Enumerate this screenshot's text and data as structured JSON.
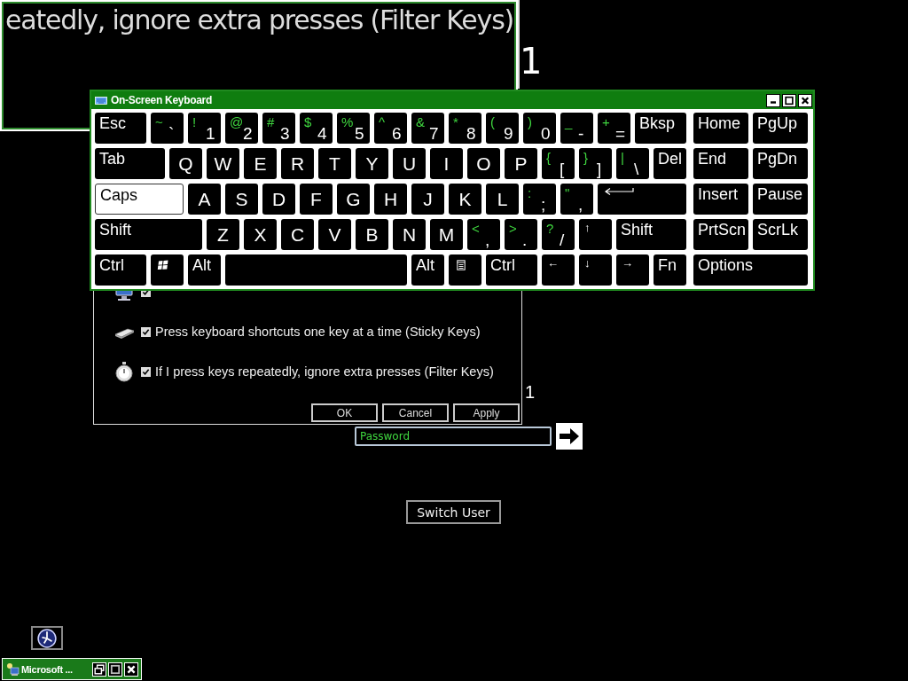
{
  "magnifier": {
    "text": "eatedly, ignore extra presses (Filter Keys)",
    "side_text": "1"
  },
  "accessibility_dialog": {
    "options": [
      {
        "checked": true
      },
      {
        "label": "Press keyboard shortcuts one key at a time (Sticky Keys)",
        "checked": true
      },
      {
        "label": "If I press keys repeatedly, ignore extra presses (Filter Keys)",
        "checked": true
      }
    ],
    "buttons": [
      "OK",
      "Cancel",
      "Apply"
    ],
    "side_text": "1"
  },
  "on_screen_keyboard": {
    "title": "On-Screen Keyboard",
    "rows": [
      {
        "keys": [
          {
            "kind": "text",
            "label": "Esc",
            "pressed": false
          },
          {
            "kind": "dual",
            "shift": "~",
            "label": "`",
            "pressed": false
          },
          {
            "kind": "dual",
            "shift": "!",
            "label": "1",
            "pressed": false
          },
          {
            "kind": "dual",
            "shift": "@",
            "label": "2",
            "pressed": false
          },
          {
            "kind": "dual",
            "shift": "#",
            "label": "3",
            "pressed": false
          },
          {
            "kind": "dual",
            "shift": "$",
            "label": "4",
            "pressed": false
          },
          {
            "kind": "dual",
            "shift": "%",
            "label": "5",
            "pressed": false
          },
          {
            "kind": "dual",
            "shift": "^",
            "label": "6",
            "pressed": false
          },
          {
            "kind": "dual",
            "shift": "&",
            "label": "7",
            "pressed": false
          },
          {
            "kind": "dual",
            "shift": "*",
            "label": "8",
            "pressed": false
          },
          {
            "kind": "dual",
            "shift": "(",
            "label": "9",
            "pressed": false
          },
          {
            "kind": "dual",
            "shift": ")",
            "label": "0",
            "pressed": false
          },
          {
            "kind": "dual",
            "shift": "_",
            "label": "-",
            "pressed": false
          },
          {
            "kind": "dual",
            "shift": "+",
            "label": "=",
            "pressed": false
          },
          {
            "kind": "text",
            "label": "Bksp",
            "pressed": false
          }
        ]
      },
      {
        "keys": [
          {
            "kind": "text",
            "label": "Tab",
            "pressed": false
          },
          {
            "kind": "letter",
            "label": "Q",
            "pressed": false
          },
          {
            "kind": "letter",
            "label": "W",
            "pressed": false
          },
          {
            "kind": "letter",
            "label": "E",
            "pressed": false
          },
          {
            "kind": "letter",
            "label": "R",
            "pressed": false
          },
          {
            "kind": "letter",
            "label": "T",
            "pressed": false
          },
          {
            "kind": "letter",
            "label": "Y",
            "pressed": false
          },
          {
            "kind": "letter",
            "label": "U",
            "pressed": false
          },
          {
            "kind": "letter",
            "label": "I",
            "pressed": false
          },
          {
            "kind": "letter",
            "label": "O",
            "pressed": false
          },
          {
            "kind": "letter",
            "label": "P",
            "pressed": false
          },
          {
            "kind": "dual",
            "shift": "{",
            "label": "[",
            "pressed": false
          },
          {
            "kind": "dual",
            "shift": "}",
            "label": "]",
            "pressed": false
          },
          {
            "kind": "dual",
            "shift": "|",
            "label": "\\",
            "pressed": false
          },
          {
            "kind": "text",
            "label": "Del",
            "pressed": false
          }
        ]
      },
      {
        "keys": [
          {
            "kind": "text",
            "label": "Caps",
            "pressed": true
          },
          {
            "kind": "letter",
            "label": "A",
            "pressed": false
          },
          {
            "kind": "letter",
            "label": "S",
            "pressed": false
          },
          {
            "kind": "letter",
            "label": "D",
            "pressed": false
          },
          {
            "kind": "letter",
            "label": "F",
            "pressed": false
          },
          {
            "kind": "letter",
            "label": "G",
            "pressed": false
          },
          {
            "kind": "letter",
            "label": "H",
            "pressed": false
          },
          {
            "kind": "letter",
            "label": "J",
            "pressed": false
          },
          {
            "kind": "letter",
            "label": "K",
            "pressed": false
          },
          {
            "kind": "letter",
            "label": "L",
            "pressed": false
          },
          {
            "kind": "dual",
            "shift": ":",
            "label": ";",
            "pressed": false
          },
          {
            "kind": "dual",
            "shift": "\"",
            "label": ",",
            "pressed": false
          },
          {
            "kind": "enter",
            "pressed": false
          }
        ]
      },
      {
        "keys": [
          {
            "kind": "text",
            "label": "Shift",
            "pressed": false
          },
          {
            "kind": "letter",
            "label": "Z",
            "pressed": false
          },
          {
            "kind": "letter",
            "label": "X",
            "pressed": false
          },
          {
            "kind": "letter",
            "label": "C",
            "pressed": false
          },
          {
            "kind": "letter",
            "label": "V",
            "pressed": false
          },
          {
            "kind": "letter",
            "label": "B",
            "pressed": false
          },
          {
            "kind": "letter",
            "label": "N",
            "pressed": false
          },
          {
            "kind": "letter",
            "label": "M",
            "pressed": false
          },
          {
            "kind": "dual",
            "shift": "<",
            "label": ",",
            "pressed": false
          },
          {
            "kind": "dual",
            "shift": ">",
            "label": ".",
            "pressed": false
          },
          {
            "kind": "dual",
            "shift": "?",
            "label": "/",
            "pressed": false
          },
          {
            "kind": "small",
            "label": "↑",
            "pressed": false
          },
          {
            "kind": "text",
            "label": "Shift",
            "pressed": false
          }
        ]
      },
      {
        "keys": [
          {
            "kind": "text",
            "label": "Ctrl",
            "pressed": false
          },
          {
            "kind": "windows",
            "pressed": false
          },
          {
            "kind": "text",
            "label": "Alt",
            "pressed": false
          },
          {
            "kind": "space",
            "pressed": false
          },
          {
            "kind": "text",
            "label": "Alt",
            "pressed": false
          },
          {
            "kind": "menu",
            "pressed": false
          },
          {
            "kind": "text",
            "label": "Ctrl",
            "pressed": false
          },
          {
            "kind": "small",
            "label": "←",
            "pressed": false
          },
          {
            "kind": "small",
            "label": "↓",
            "pressed": false
          },
          {
            "kind": "small",
            "label": "→",
            "pressed": false
          },
          {
            "kind": "text",
            "label": "Fn",
            "pressed": false
          }
        ]
      }
    ],
    "nav_rows": [
      {
        "keys": [
          {
            "label": "Home",
            "pressed": false
          },
          {
            "label": "PgUp",
            "pressed": false
          }
        ]
      },
      {
        "keys": [
          {
            "label": "End",
            "pressed": false
          },
          {
            "label": "PgDn",
            "pressed": false
          }
        ]
      },
      {
        "keys": [
          {
            "label": "Insert",
            "pressed": false
          },
          {
            "label": "Pause",
            "pressed": false
          }
        ]
      },
      {
        "keys": [
          {
            "label": "PrtScn",
            "pressed": false
          },
          {
            "label": "ScrLk",
            "pressed": false
          }
        ]
      },
      {
        "keys": [
          {
            "label": "Options",
            "pressed": false
          }
        ]
      }
    ]
  },
  "login": {
    "password_placeholder": "Password",
    "switch_user": "Switch User"
  },
  "taskbar_item": {
    "label": "Microsoft ..."
  }
}
